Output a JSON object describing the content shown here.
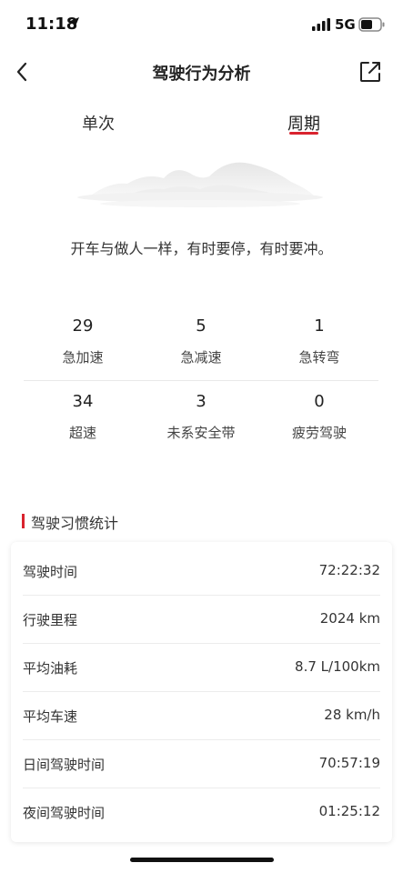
{
  "status_bar": {
    "time": "11:18",
    "network": "5G"
  },
  "header": {
    "title": "驾驶行为分析"
  },
  "tabs": [
    {
      "label": "单次",
      "active": false
    },
    {
      "label": "周期",
      "active": true
    }
  ],
  "accent_color": "#d9232e",
  "quote": "开车与做人一样，有时要停，有时要冲。",
  "stats": [
    {
      "value": "29",
      "label": "急加速"
    },
    {
      "value": "5",
      "label": "急减速"
    },
    {
      "value": "1",
      "label": "急转弯"
    },
    {
      "value": "34",
      "label": "超速"
    },
    {
      "value": "3",
      "label": "未系安全带"
    },
    {
      "value": "0",
      "label": "疲劳驾驶"
    }
  ],
  "habits": {
    "title": "驾驶习惯统计",
    "rows": [
      {
        "key": "驾驶时间",
        "value": "72:22:32"
      },
      {
        "key": "行驶里程",
        "value": "2024 km"
      },
      {
        "key": "平均油耗",
        "value": "8.7 L/100km"
      },
      {
        "key": "平均车速",
        "value": "28 km/h"
      },
      {
        "key": "日间驾驶时间",
        "value": "70:57:19"
      },
      {
        "key": "夜间驾驶时间",
        "value": "01:25:12"
      }
    ]
  }
}
